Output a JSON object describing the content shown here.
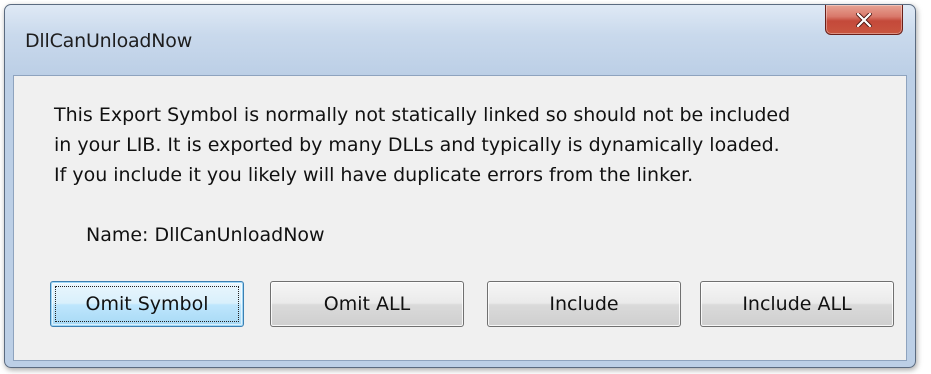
{
  "dialog": {
    "title": "DllCanUnloadNow",
    "close_icon": "close-icon",
    "close_color": "#c4493a",
    "message_lines": [
      "This Export Symbol is normally not statically linked so should not be included",
      "in your LIB. It is exported by many DLLs and typically is dynamically loaded.",
      "If you include it you likely will have duplicate errors from the linker."
    ],
    "name_label": "Name: DllCanUnloadNow",
    "buttons": {
      "omit_symbol": "Omit Symbol",
      "omit_all": "Omit ALL",
      "include": "Include",
      "include_all": "Include ALL"
    },
    "default_button": "Omit Symbol"
  }
}
